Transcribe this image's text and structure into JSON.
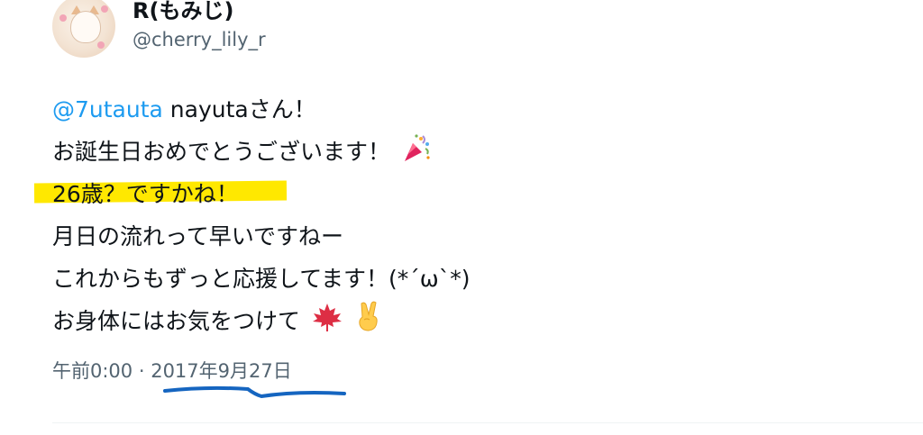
{
  "author": {
    "display_name": "R(もみじ)",
    "handle": "@cherry_lily_r",
    "avatar_icon": "cat-avatar"
  },
  "tweet": {
    "mention": "@7utauta",
    "line1_rest": " nayutaさん！",
    "line2": "お誕生日おめでとうございます！",
    "line3": "26歳？ですかね！",
    "line4": "月日の流れって早いですねー",
    "line5": "これからもずっと応援してます！(*´ω`*)",
    "line6": "お身体にはお気をつけて",
    "emojis": [
      "party-popper-icon",
      "maple-leaf-icon",
      "victory-hand-icon"
    ]
  },
  "meta": {
    "time": "午前0:00",
    "separator": " · ",
    "date": "2017年9月27日"
  },
  "annotations": {
    "highlight_color": "#ffe800",
    "underline_color": "#1565c0"
  }
}
